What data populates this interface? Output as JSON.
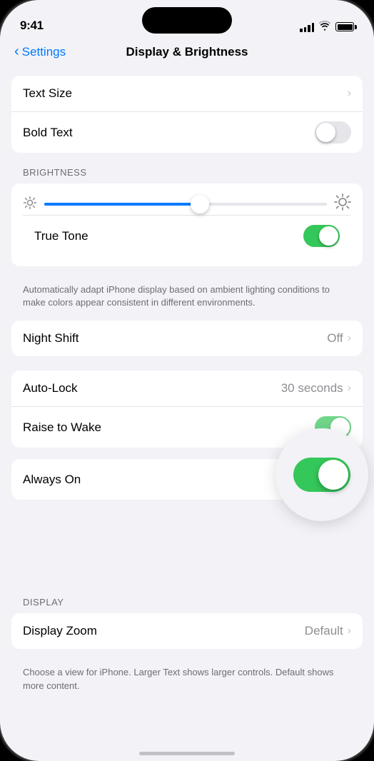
{
  "statusBar": {
    "time": "9:41",
    "battery": "full"
  },
  "navigation": {
    "backLabel": "Settings",
    "title": "Display & Brightness"
  },
  "sections": {
    "textSettings": {
      "rows": [
        {
          "label": "Text Size",
          "type": "navigate"
        },
        {
          "label": "Bold Text",
          "type": "toggle",
          "value": false
        }
      ]
    },
    "brightnessSection": {
      "sectionLabel": "BRIGHTNESS",
      "sliderPercent": 55,
      "trueTone": {
        "label": "True Tone",
        "value": true
      },
      "description": "Automatically adapt iPhone display based on ambient lighting conditions to make colors appear consistent in different environments."
    },
    "nightShift": {
      "label": "Night Shift",
      "value": "Off",
      "type": "navigate"
    },
    "lockSection": {
      "rows": [
        {
          "label": "Auto-Lock",
          "value": "30 seconds",
          "type": "navigate"
        },
        {
          "label": "Raise to Wake",
          "type": "toggle",
          "value": true
        }
      ]
    },
    "alwaysOn": {
      "label": "Always On",
      "value": true
    },
    "displaySection": {
      "sectionLabel": "DISPLAY",
      "rows": [
        {
          "label": "Display Zoom",
          "value": "Default",
          "type": "navigate"
        }
      ],
      "description": "Choose a view for iPhone. Larger Text shows larger controls. Default shows more content."
    }
  }
}
